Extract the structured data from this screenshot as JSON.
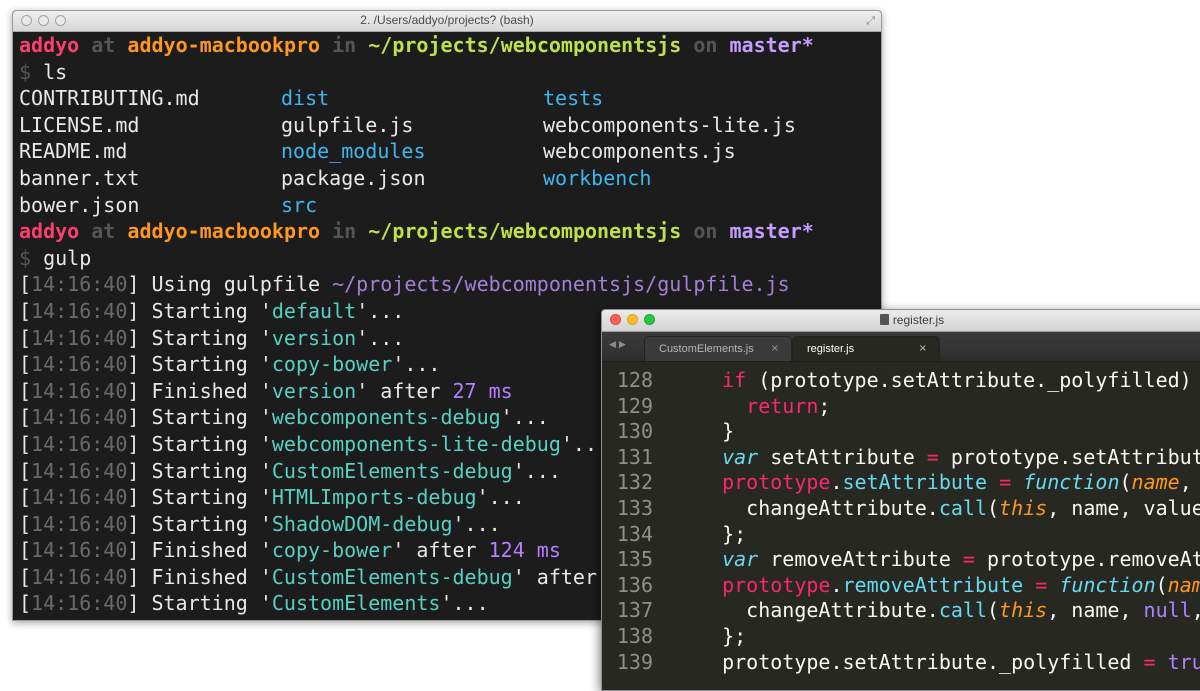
{
  "terminal": {
    "title": "2. /Users/addyo/projects? (bash)",
    "prompt": {
      "user": "addyo",
      "at": "at",
      "host": "addyo-macbookpro",
      "in": "in",
      "path": "~/projects/webcomponentsjs",
      "on": "on",
      "branch": "master*",
      "symbol": "$"
    },
    "commands": [
      "ls",
      "gulp"
    ],
    "ls_rows": [
      [
        "CONTRIBUTING.md",
        "dist",
        "tests"
      ],
      [
        "LICENSE.md",
        "gulpfile.js",
        "webcomponents-lite.js"
      ],
      [
        "README.md",
        "node_modules",
        "webcomponents.js"
      ],
      [
        "banner.txt",
        "package.json",
        "workbench"
      ],
      [
        "bower.json",
        "src",
        ""
      ]
    ],
    "gulp": {
      "timestamp": "14:16:40",
      "using_label": "Using gulpfile",
      "using_path": "~/projects/webcomponentsjs/gulpfile.js",
      "lines": [
        {
          "verb": "Starting",
          "task": "default",
          "tail": "'..."
        },
        {
          "verb": "Starting",
          "task": "version",
          "tail": "'..."
        },
        {
          "verb": "Starting",
          "task": "copy-bower",
          "tail": "'..."
        },
        {
          "verb": "Finished",
          "task": "version",
          "tail": "' after ",
          "num": "27 ms"
        },
        {
          "verb": "Starting",
          "task": "webcomponents-debug",
          "tail": "'..."
        },
        {
          "verb": "Starting",
          "task": "webcomponents-lite-debug",
          "tail": "'..."
        },
        {
          "verb": "Starting",
          "task": "CustomElements-debug",
          "tail": "'..."
        },
        {
          "verb": "Starting",
          "task": "HTMLImports-debug",
          "tail": "'..."
        },
        {
          "verb": "Starting",
          "task": "ShadowDOM-debug",
          "tail": "'..."
        },
        {
          "verb": "Finished",
          "task": "copy-bower",
          "tail": "' after ",
          "num": "124 ms"
        },
        {
          "verb": "Finished",
          "task": "CustomElements-debug",
          "tail": "' after"
        },
        {
          "verb": "Starting",
          "task": "CustomElements",
          "tail": "'..."
        }
      ]
    }
  },
  "editor": {
    "title": "register.js",
    "tabs": [
      {
        "label": "CustomElements.js",
        "close": "×"
      },
      {
        "label": "register.js",
        "close": "×"
      }
    ],
    "lines": [
      {
        "n": "128",
        "tokens": [
          [
            "src",
            "  "
          ],
          [
            "kw",
            "if"
          ],
          [
            "src",
            " (prototype.setAttribute._polyfilled)"
          ]
        ]
      },
      {
        "n": "129",
        "tokens": [
          [
            "src",
            "    "
          ],
          [
            "kw",
            "return"
          ],
          [
            "src",
            ";"
          ]
        ]
      },
      {
        "n": "130",
        "tokens": [
          [
            "src",
            "  }"
          ]
        ]
      },
      {
        "n": "131",
        "tokens": [
          [
            "src",
            "  "
          ],
          [
            "st",
            "var"
          ],
          [
            "src",
            " setAttribute "
          ],
          [
            "kw",
            "="
          ],
          [
            "src",
            " prototype.setAttribut"
          ]
        ]
      },
      {
        "n": "132",
        "tokens": [
          [
            "src",
            "  "
          ],
          [
            "kw",
            "prototype"
          ],
          [
            "src",
            "."
          ],
          [
            "sv",
            "setAttribute"
          ],
          [
            "src",
            " "
          ],
          [
            "kw",
            "="
          ],
          [
            "src",
            " "
          ],
          [
            "st",
            "function"
          ],
          [
            "src",
            "("
          ],
          [
            "sup",
            "name"
          ],
          [
            "src",
            ", "
          ]
        ]
      },
      {
        "n": "133",
        "tokens": [
          [
            "src",
            "    changeAttribute."
          ],
          [
            "sv",
            "call"
          ],
          [
            "src",
            "("
          ],
          [
            "sup",
            "this"
          ],
          [
            "src",
            ", name, value"
          ]
        ]
      },
      {
        "n": "134",
        "tokens": [
          [
            "src",
            "  };"
          ]
        ]
      },
      {
        "n": "135",
        "tokens": [
          [
            "src",
            "  "
          ],
          [
            "st",
            "var"
          ],
          [
            "src",
            " removeAttribute "
          ],
          [
            "kw",
            "="
          ],
          [
            "src",
            " prototype.removeAt"
          ]
        ]
      },
      {
        "n": "136",
        "tokens": [
          [
            "src",
            "  "
          ],
          [
            "kw",
            "prototype"
          ],
          [
            "src",
            "."
          ],
          [
            "sv",
            "removeAttribute"
          ],
          [
            "src",
            " "
          ],
          [
            "kw",
            "="
          ],
          [
            "src",
            " "
          ],
          [
            "st",
            "function"
          ],
          [
            "src",
            "("
          ],
          [
            "sup",
            "nam"
          ]
        ]
      },
      {
        "n": "137",
        "tokens": [
          [
            "src",
            "    changeAttribute."
          ],
          [
            "sv",
            "call"
          ],
          [
            "src",
            "("
          ],
          [
            "sup",
            "this"
          ],
          [
            "src",
            ", name, "
          ],
          [
            "lit",
            "null"
          ],
          [
            "src",
            ","
          ]
        ]
      },
      {
        "n": "138",
        "tokens": [
          [
            "src",
            "  };"
          ]
        ]
      },
      {
        "n": "139",
        "tokens": [
          [
            "src",
            "  prototype.setAttribute._polyfilled "
          ],
          [
            "kw",
            "="
          ],
          [
            "src",
            " "
          ],
          [
            "lit",
            "tru"
          ]
        ]
      }
    ]
  },
  "colors": {
    "terminal_bg": "#1c1c1d",
    "editor_bg": "#272822",
    "prompt_user": "#ff3e6d",
    "prompt_host": "#fd971f",
    "prompt_path": "#bde04b",
    "prompt_branch": "#c59dff",
    "ls_dir": "#3cb7ef",
    "gulp_task": "#56d0c3",
    "gulp_time": "#b57fff"
  },
  "icons": [
    "close-icon",
    "resize-icon",
    "document-icon",
    "back-arrow-icon",
    "forward-arrow-icon"
  ]
}
